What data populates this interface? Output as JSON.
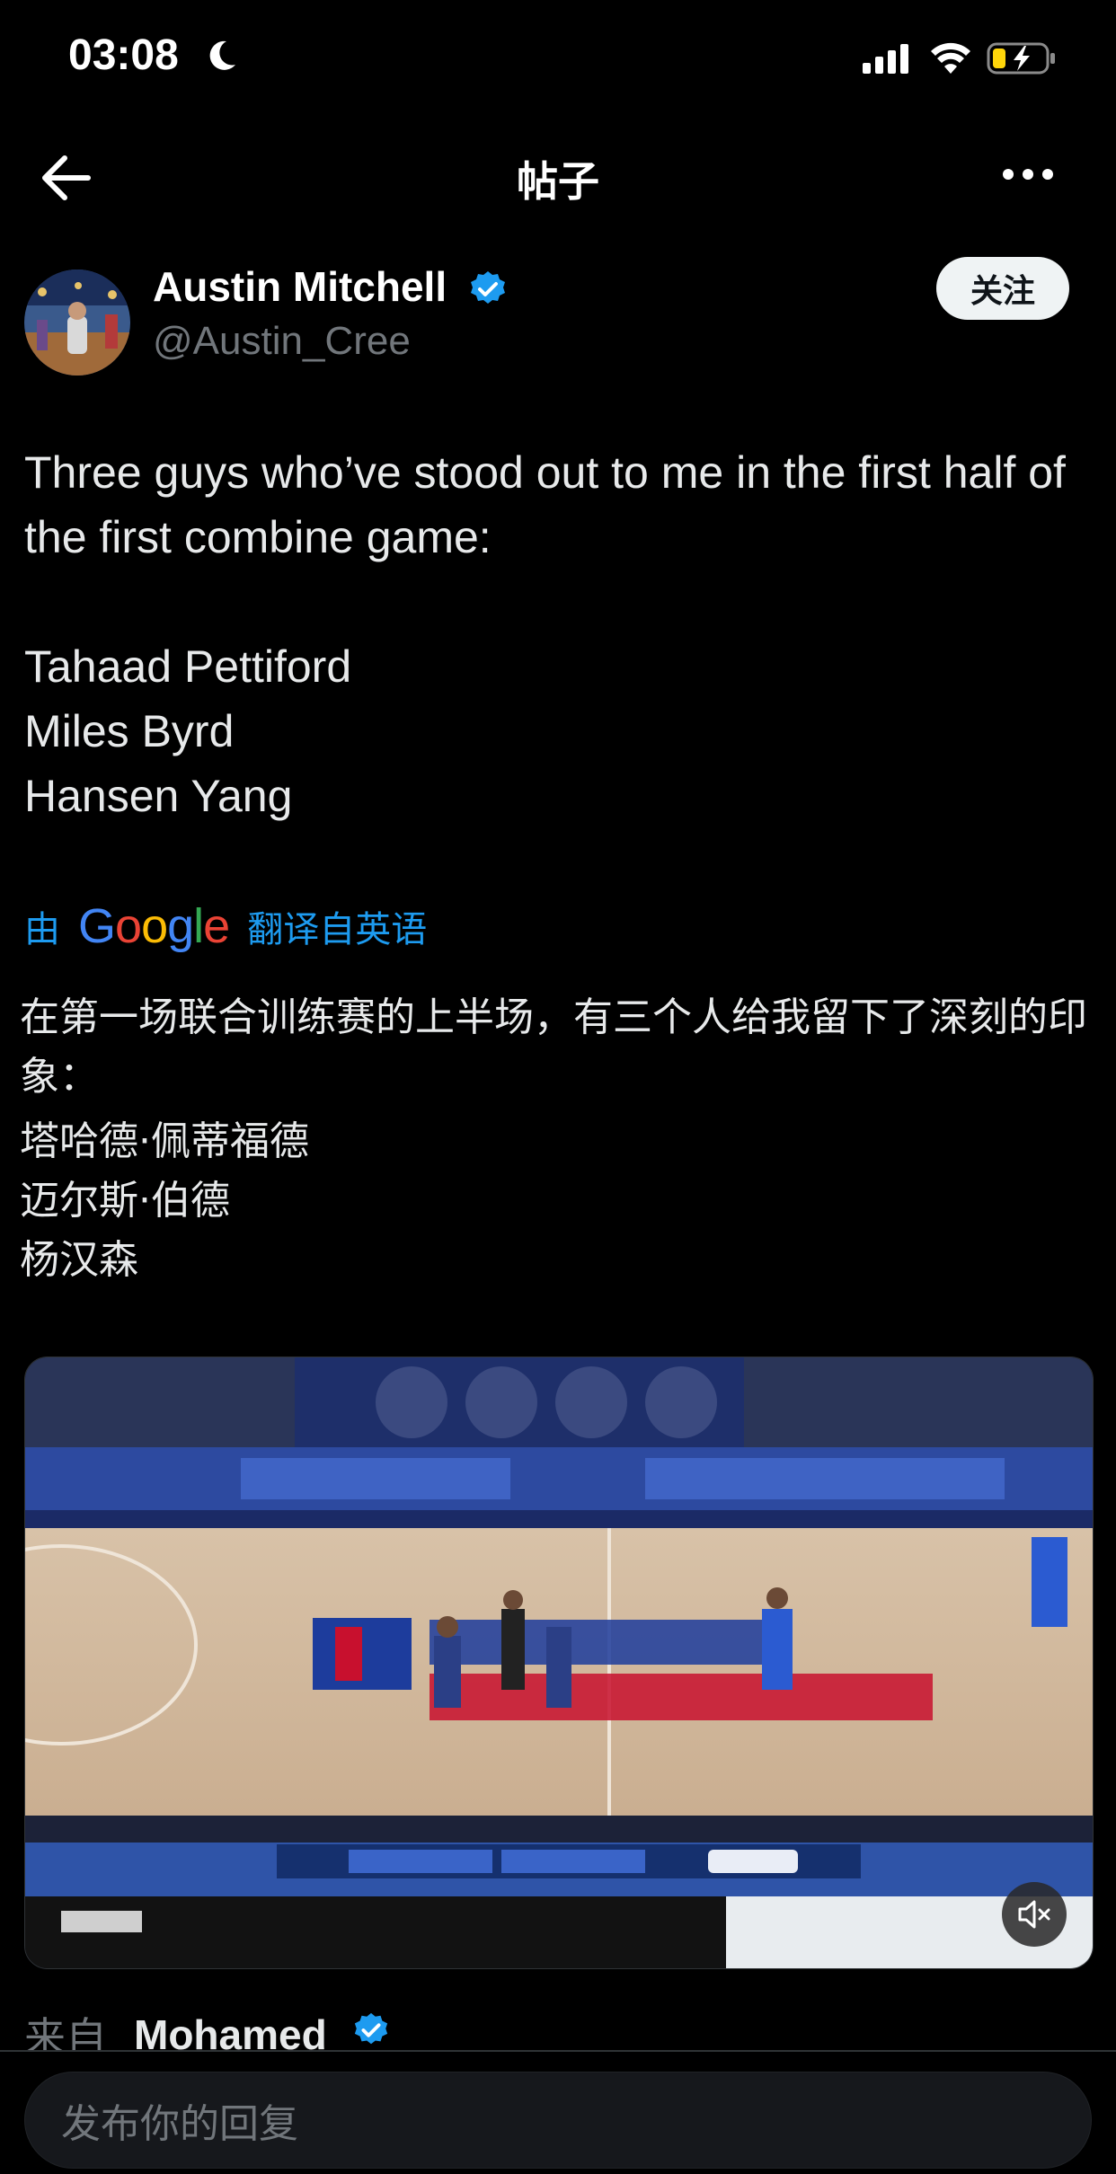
{
  "status_bar": {
    "time": "03:08",
    "icons": [
      "moon-icon",
      "cellular-signal-icon",
      "wifi-icon",
      "battery-charging-icon"
    ]
  },
  "header": {
    "title": "帖子",
    "back_icon": "arrow-left-icon",
    "more_icon": "more-horizontal-icon"
  },
  "author": {
    "name": "Austin Mitchell",
    "handle": "@Austin_Cree",
    "verified": true,
    "follow_label": "关注"
  },
  "tweet": {
    "lines": [
      "Three guys who’ve stood out to me in the first half of the first combine game:",
      "Tahaad Pettiford",
      "Miles Byrd",
      "Hansen Yang"
    ]
  },
  "translation": {
    "prefix": "由",
    "provider": "Google",
    "suffix": "翻译自英语",
    "intro": "在第一场联合训练赛的上半场，有三个人给我留下了深刻的印象：",
    "names": [
      "塔哈德·佩蒂福德",
      "迈尔斯·伯德",
      "杨汉森"
    ]
  },
  "video": {
    "mute_icon": "speaker-muted-icon"
  },
  "quote": {
    "from_label": "来自",
    "from_name": "Mohamed",
    "verified": true
  },
  "reply": {
    "placeholder": "发布你的回复"
  },
  "colors": {
    "background": "#000000",
    "text": "#e7e9ea",
    "muted": "#71767b",
    "accent": "#1d9bf0",
    "follow_bg": "#eff3f4"
  }
}
